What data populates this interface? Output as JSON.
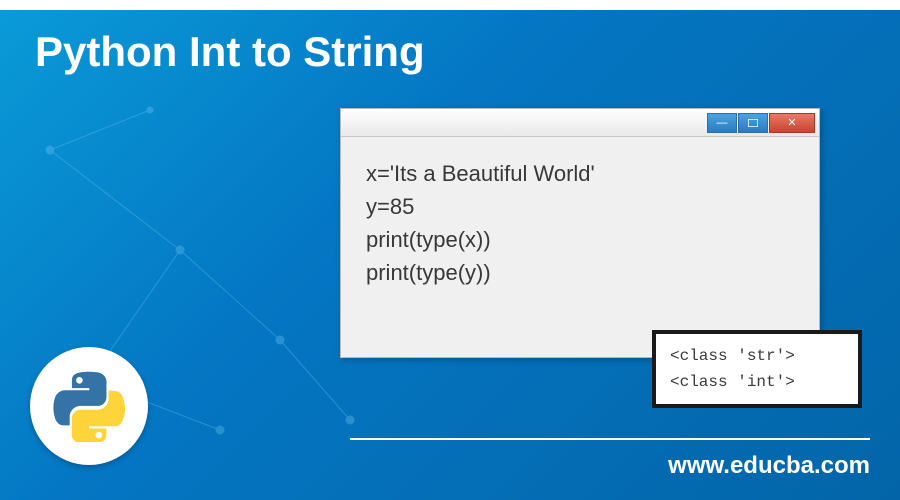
{
  "title": "Python Int to String",
  "code": {
    "line1": "x='Its a Beautiful World'",
    "line2": "y=85",
    "line3": "print(type(x))",
    "line4": "print(type(y))"
  },
  "output": {
    "line1": "<class 'str'>",
    "line2": "<class 'int'>"
  },
  "website": "www.educba.com",
  "window_buttons": {
    "minimize": "—",
    "maximize": "□",
    "close": "✕"
  }
}
